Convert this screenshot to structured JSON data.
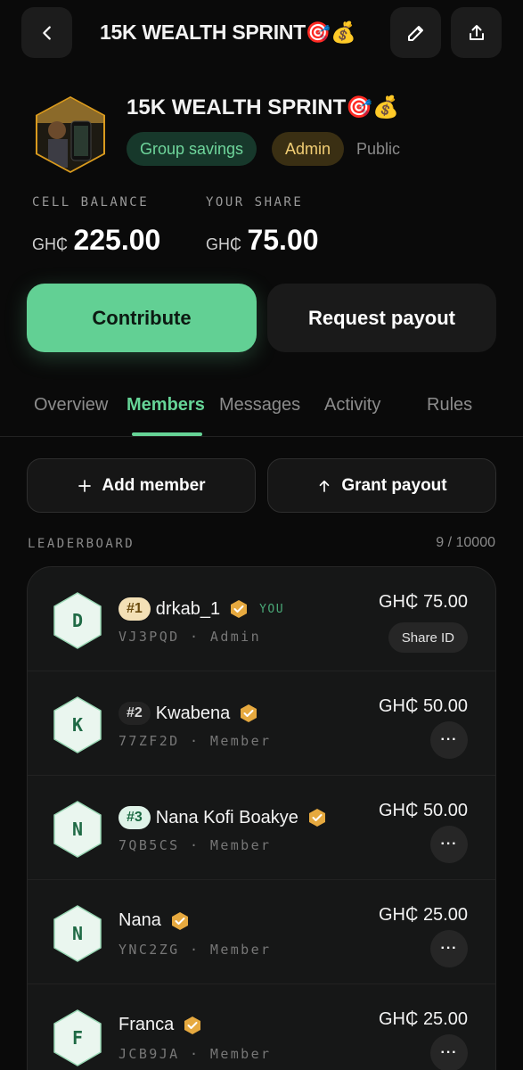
{
  "header": {
    "title": "15K WEALTH SPRINT🎯💰"
  },
  "group": {
    "name": "15K WEALTH SPRINT🎯💰",
    "tags": {
      "type": "Group savings",
      "role": "Admin",
      "visibility": "Public"
    },
    "balance": {
      "cell_label": "CELL BALANCE",
      "share_label": "YOUR SHARE",
      "currency": "GH₵",
      "cell_amount": "225.00",
      "share_amount": "75.00"
    }
  },
  "actions": {
    "contribute": "Contribute",
    "request_payout": "Request payout"
  },
  "tabs": [
    "Overview",
    "Members",
    "Messages",
    "Activity",
    "Rules"
  ],
  "active_tab": "Members",
  "member_actions": {
    "add": "Add member",
    "grant": "Grant payout"
  },
  "leaderboard": {
    "label": "LEADERBOARD",
    "count": "9 / 10000",
    "share_id_label": "Share ID",
    "more_label": "···",
    "members": [
      {
        "initial": "D",
        "rank": "#1",
        "name": "drkab_1",
        "you": "YOU",
        "code": "VJ3PQD",
        "role": "Admin",
        "amount": "GH₵ 75.00"
      },
      {
        "initial": "K",
        "rank": "#2",
        "name": "Kwabena",
        "code": "77ZF2D",
        "role": "Member",
        "amount": "GH₵ 50.00"
      },
      {
        "initial": "N",
        "rank": "#3",
        "name": "Nana Kofi Boakye",
        "code": "7QB5CS",
        "role": "Member",
        "amount": "GH₵ 50.00"
      },
      {
        "initial": "N",
        "name": "Nana",
        "code": "YNC2ZG",
        "role": "Member",
        "amount": "GH₵ 25.00"
      },
      {
        "initial": "F",
        "name": "Franca",
        "code": "JCB9JA",
        "role": "Member",
        "amount": "GH₵ 25.00"
      }
    ]
  },
  "colors": {
    "accent": "#62d094",
    "background": "#0a0a0a",
    "admin_tag": "#f1cd74",
    "verified_badge": "#e6a93f"
  }
}
